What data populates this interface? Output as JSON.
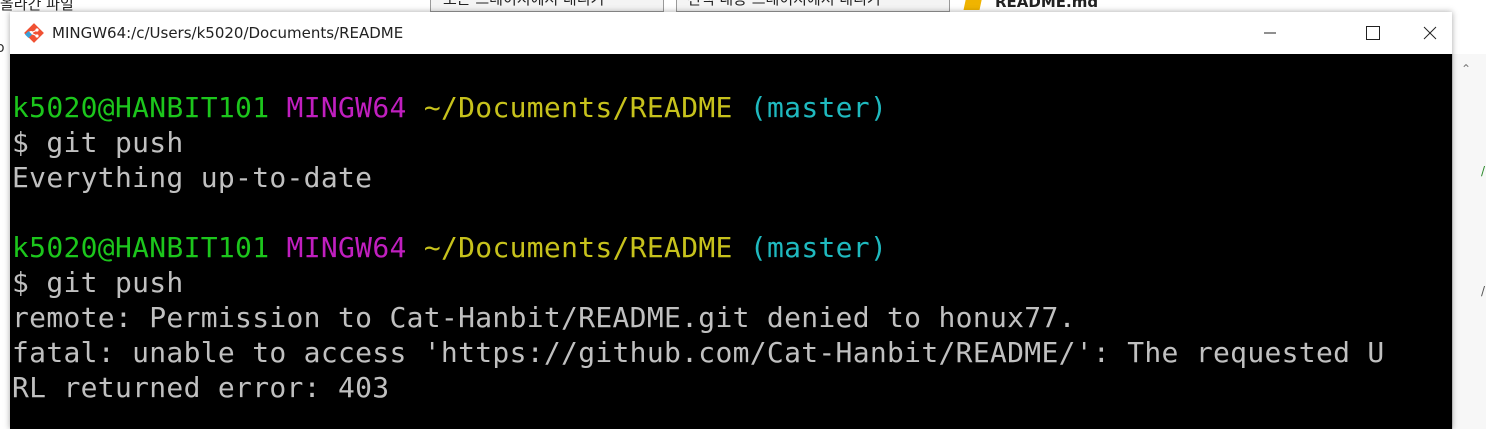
{
  "background": {
    "left_text": "올라간 파일",
    "tab1": "모든 스테이지에서 내리기",
    "tab2": "선택 내용 스테이지에서 내리기",
    "tab3": "README.md",
    "edge_char": "o"
  },
  "window": {
    "title": "MINGW64:/c/Users/k5020/Documents/README",
    "icon": "git-icon",
    "buttons": {
      "minimize": "minimize-icon",
      "maximize": "maximize-icon",
      "close": "close-icon"
    }
  },
  "colors": {
    "user_host": "#1cc61c",
    "shell": "#c01fbf",
    "path": "#c7c21c",
    "branch": "#1fb9bf",
    "text": "#c0c0c0",
    "background": "#000000"
  },
  "terminal": {
    "prompt1": {
      "user_host": "k5020@HANBIT101",
      "shell": "MINGW64",
      "path": "~/Documents/README",
      "branch": "(master)"
    },
    "cmd1": "$ git push",
    "out1": "Everything up-to-date",
    "prompt2": {
      "user_host": "k5020@HANBIT101",
      "shell": "MINGW64",
      "path": "~/Documents/README",
      "branch": "(master)"
    },
    "cmd2": "$ git push",
    "out2": "remote: Permission to Cat-Hanbit/README.git denied to honux77.",
    "out3": "fatal: unable to access 'https://github.com/Cat-Hanbit/README/': The requested U",
    "out4": "RL returned error: 403"
  }
}
